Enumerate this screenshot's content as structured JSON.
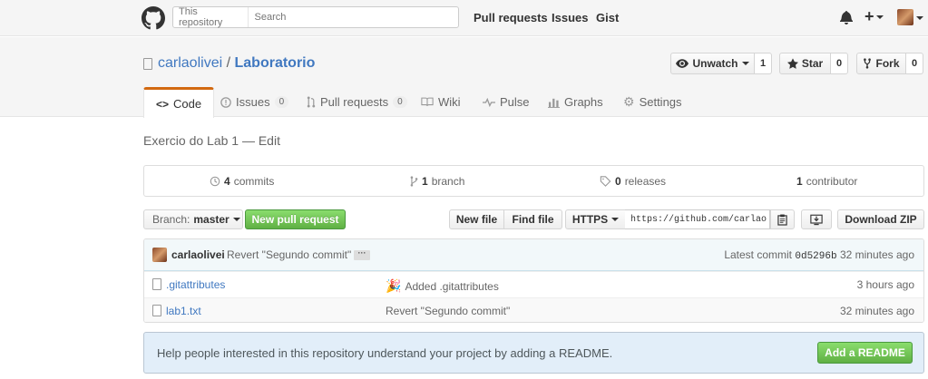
{
  "header": {
    "search_scope": "This repository",
    "search_placeholder": "Search",
    "nav": [
      "Pull requests",
      "Issues",
      "Gist"
    ],
    "icons": [
      "github-octocat",
      "bell",
      "plus",
      "avatar"
    ]
  },
  "repo": {
    "owner": "carlaolivei",
    "separator": "/",
    "name": "Laboratorio",
    "unwatch_label": "Unwatch",
    "unwatch_count": "1",
    "star_label": "Star",
    "star_count": "0",
    "fork_label": "Fork",
    "fork_count": "0"
  },
  "tabs": [
    {
      "label": "Code",
      "icon": "code"
    },
    {
      "label": "Issues",
      "counter": "0",
      "icon": "issue"
    },
    {
      "label": "Pull requests",
      "counter": "0",
      "icon": "pull-request"
    },
    {
      "label": "Wiki",
      "icon": "book"
    },
    {
      "label": "Pulse",
      "icon": "pulse"
    },
    {
      "label": "Graphs",
      "icon": "graph"
    },
    {
      "label": "Settings",
      "icon": "gear"
    }
  ],
  "description": "Exercio do Lab 1 — Edit",
  "summary": {
    "commits_count": "4",
    "commits_label": "commits",
    "branch_count": "1",
    "branch_label": "branch",
    "releases_count": "0",
    "releases_label": "releases",
    "contributor_count": "1",
    "contributor_label": "contributor"
  },
  "file_nav": {
    "branch_prefix": "Branch:",
    "branch_name": "master",
    "new_pr": "New pull request",
    "new_file": "New file",
    "find_file": "Find file",
    "protocol": "HTTPS",
    "clone_url": "https://github.com/carlao",
    "download": "Download ZIP"
  },
  "commit": {
    "author": "carlaolivei",
    "message": "Revert \"Segundo commit\"",
    "ellipsis": "···",
    "latest_label": "Latest commit",
    "sha": "0d5296b",
    "age": "32 minutes ago"
  },
  "files": [
    {
      "name": ".gitattributes",
      "message": "Added .gitattributes",
      "age": "3 hours ago",
      "emoji": "tada"
    },
    {
      "name": "lab1.txt",
      "message": "Revert \"Segundo commit\"",
      "age": "32 minutes ago"
    }
  ],
  "readme": {
    "text": "Help people interested in this repository understand your project by adding a README.",
    "button": "Add a README"
  },
  "colors": {
    "link": "#4078c0",
    "tab_accent": "#d26911",
    "green_button": "#60b044",
    "readme_bg": "#e2eef9",
    "commit_bar_bg": "#f2f8fa"
  }
}
